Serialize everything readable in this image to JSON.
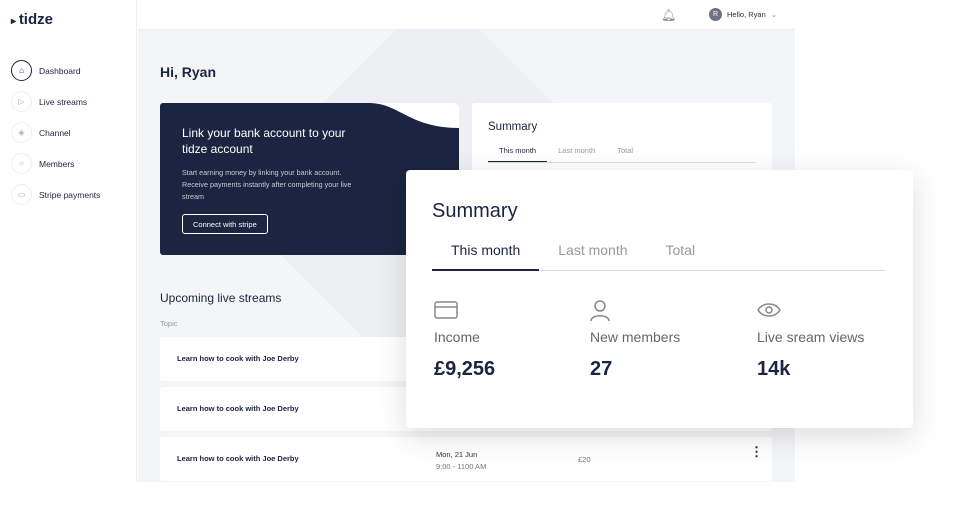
{
  "app": {
    "logo": "tidze"
  },
  "sidebar": {
    "items": [
      {
        "label": "Dashboard",
        "icon": "home-icon"
      },
      {
        "label": "Live streams",
        "icon": "play-icon"
      },
      {
        "label": "Channel",
        "icon": "layers-icon"
      },
      {
        "label": "Members",
        "icon": "user-icon"
      },
      {
        "label": "Stripe payments",
        "icon": "card-icon"
      }
    ]
  },
  "header": {
    "user_initial": "R",
    "user_greeting": "Hello, Ryan"
  },
  "main": {
    "greeting": "Hi, Ryan",
    "bank": {
      "title": "Link your bank account to your tidze account",
      "body": "Start earning money by linking your bank account. Receive payments instantly after completing your live stream",
      "button": "Connect with stripe"
    },
    "summary": {
      "title": "Summary",
      "tabs": [
        "This month",
        "Last month",
        "Total"
      ]
    },
    "upcoming": {
      "title": "Upcoming live streams",
      "column_topic": "Topic",
      "rows": [
        {
          "topic": "Learn how to cook with Joe Derby"
        },
        {
          "topic": "Learn how to cook with Joe Derby"
        },
        {
          "topic": "Learn how to cook with Joe Derby",
          "date": "Mon, 21 Jun",
          "time": "9:00 - 1100 AM",
          "price": "£20"
        }
      ]
    }
  },
  "summary_popup": {
    "title": "Summary",
    "tabs": [
      "This month",
      "Last month",
      "Total"
    ],
    "stats": [
      {
        "label": "Income",
        "value": "£9,256",
        "icon": "card-icon"
      },
      {
        "label": "New members",
        "value": "27",
        "icon": "user-icon"
      },
      {
        "label": "Live sream views",
        "value": "14k",
        "icon": "eye-icon"
      }
    ]
  },
  "colors": {
    "navy": "#1b2440",
    "background": "#f4f5f7"
  }
}
